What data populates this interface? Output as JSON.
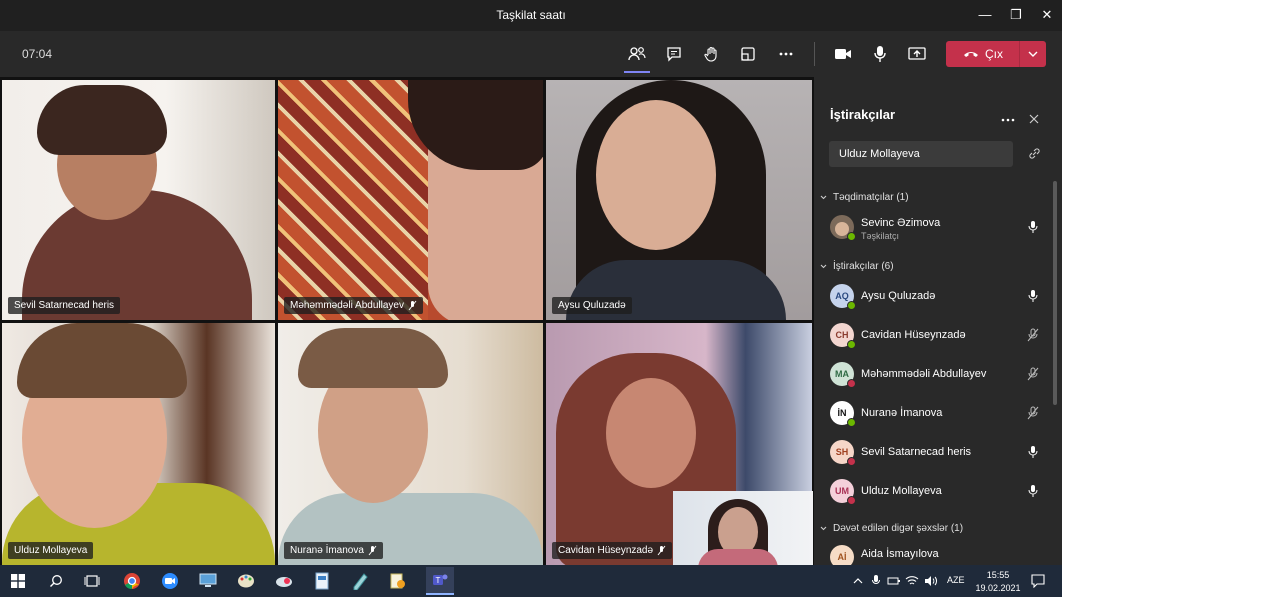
{
  "window": {
    "title": "Taşkilat saatı"
  },
  "toolbar": {
    "timer": "07:04",
    "leave_label": "Çıx"
  },
  "tiles": [
    {
      "name": "Sevil Satarnecad heris",
      "muted": false
    },
    {
      "name": "Məhəmmədəli Abdullayev",
      "muted": true
    },
    {
      "name": "Aysu Quluzadə",
      "muted": false
    },
    {
      "name": "Ulduz Mollayeva",
      "muted": false
    },
    {
      "name": "Nuranə İmanova",
      "muted": true
    },
    {
      "name": "Cavidan Hüseynzadə",
      "muted": true
    }
  ],
  "panel": {
    "title": "İştirakçılar",
    "search_value": "Ulduz Mollayeva",
    "presenters_heading": "Təqdimatçılar (1)",
    "attendees_heading": "İştirakçılar (6)",
    "invited_heading": "Dəvət edilən digər şəxslər (1)",
    "presenter": {
      "name": "Sevinc Əzimova",
      "role": "Təşkilatçı"
    },
    "attendees": [
      {
        "initials": "AQ",
        "name": "Aysu Quluzadə",
        "muted": false,
        "bg": "#c5d3ec",
        "fg": "#2b4a80",
        "status": "#6bb700"
      },
      {
        "initials": "CH",
        "name": "Cavidan Hüseynzadə",
        "muted": true,
        "bg": "#f3d6d0",
        "fg": "#8a3b2e",
        "status": "#6bb700"
      },
      {
        "initials": "MA",
        "name": "Məhəmmədəli Abdullayev",
        "muted": true,
        "bg": "#cfe3d6",
        "fg": "#2f6b45",
        "status": "#c4314b"
      },
      {
        "initials": "İN",
        "name": "Nuranə İmanova",
        "muted": true,
        "bg": "#ffffff",
        "fg": "#111111",
        "status": "#6bb700"
      },
      {
        "initials": "SH",
        "name": "Sevil Satarnecad heris",
        "muted": false,
        "bg": "#f6d6c8",
        "fg": "#a04020",
        "status": "#c4314b"
      },
      {
        "initials": "UM",
        "name": "Ulduz Mollayeva",
        "muted": false,
        "bg": "#f4d0da",
        "fg": "#a83256",
        "status": "#c4314b"
      }
    ],
    "invited": [
      {
        "initials": "Aİ",
        "name": "Aida İsmayılova",
        "bg": "#f6dcc6",
        "fg": "#a05420"
      }
    ]
  },
  "taskbar": {
    "time": "15:55",
    "date": "19.02.2021",
    "language": "AZE"
  },
  "colors": {
    "accent": "#7f85f5",
    "leave": "#c4314b",
    "available": "#6bb700",
    "busy": "#c4314b"
  }
}
